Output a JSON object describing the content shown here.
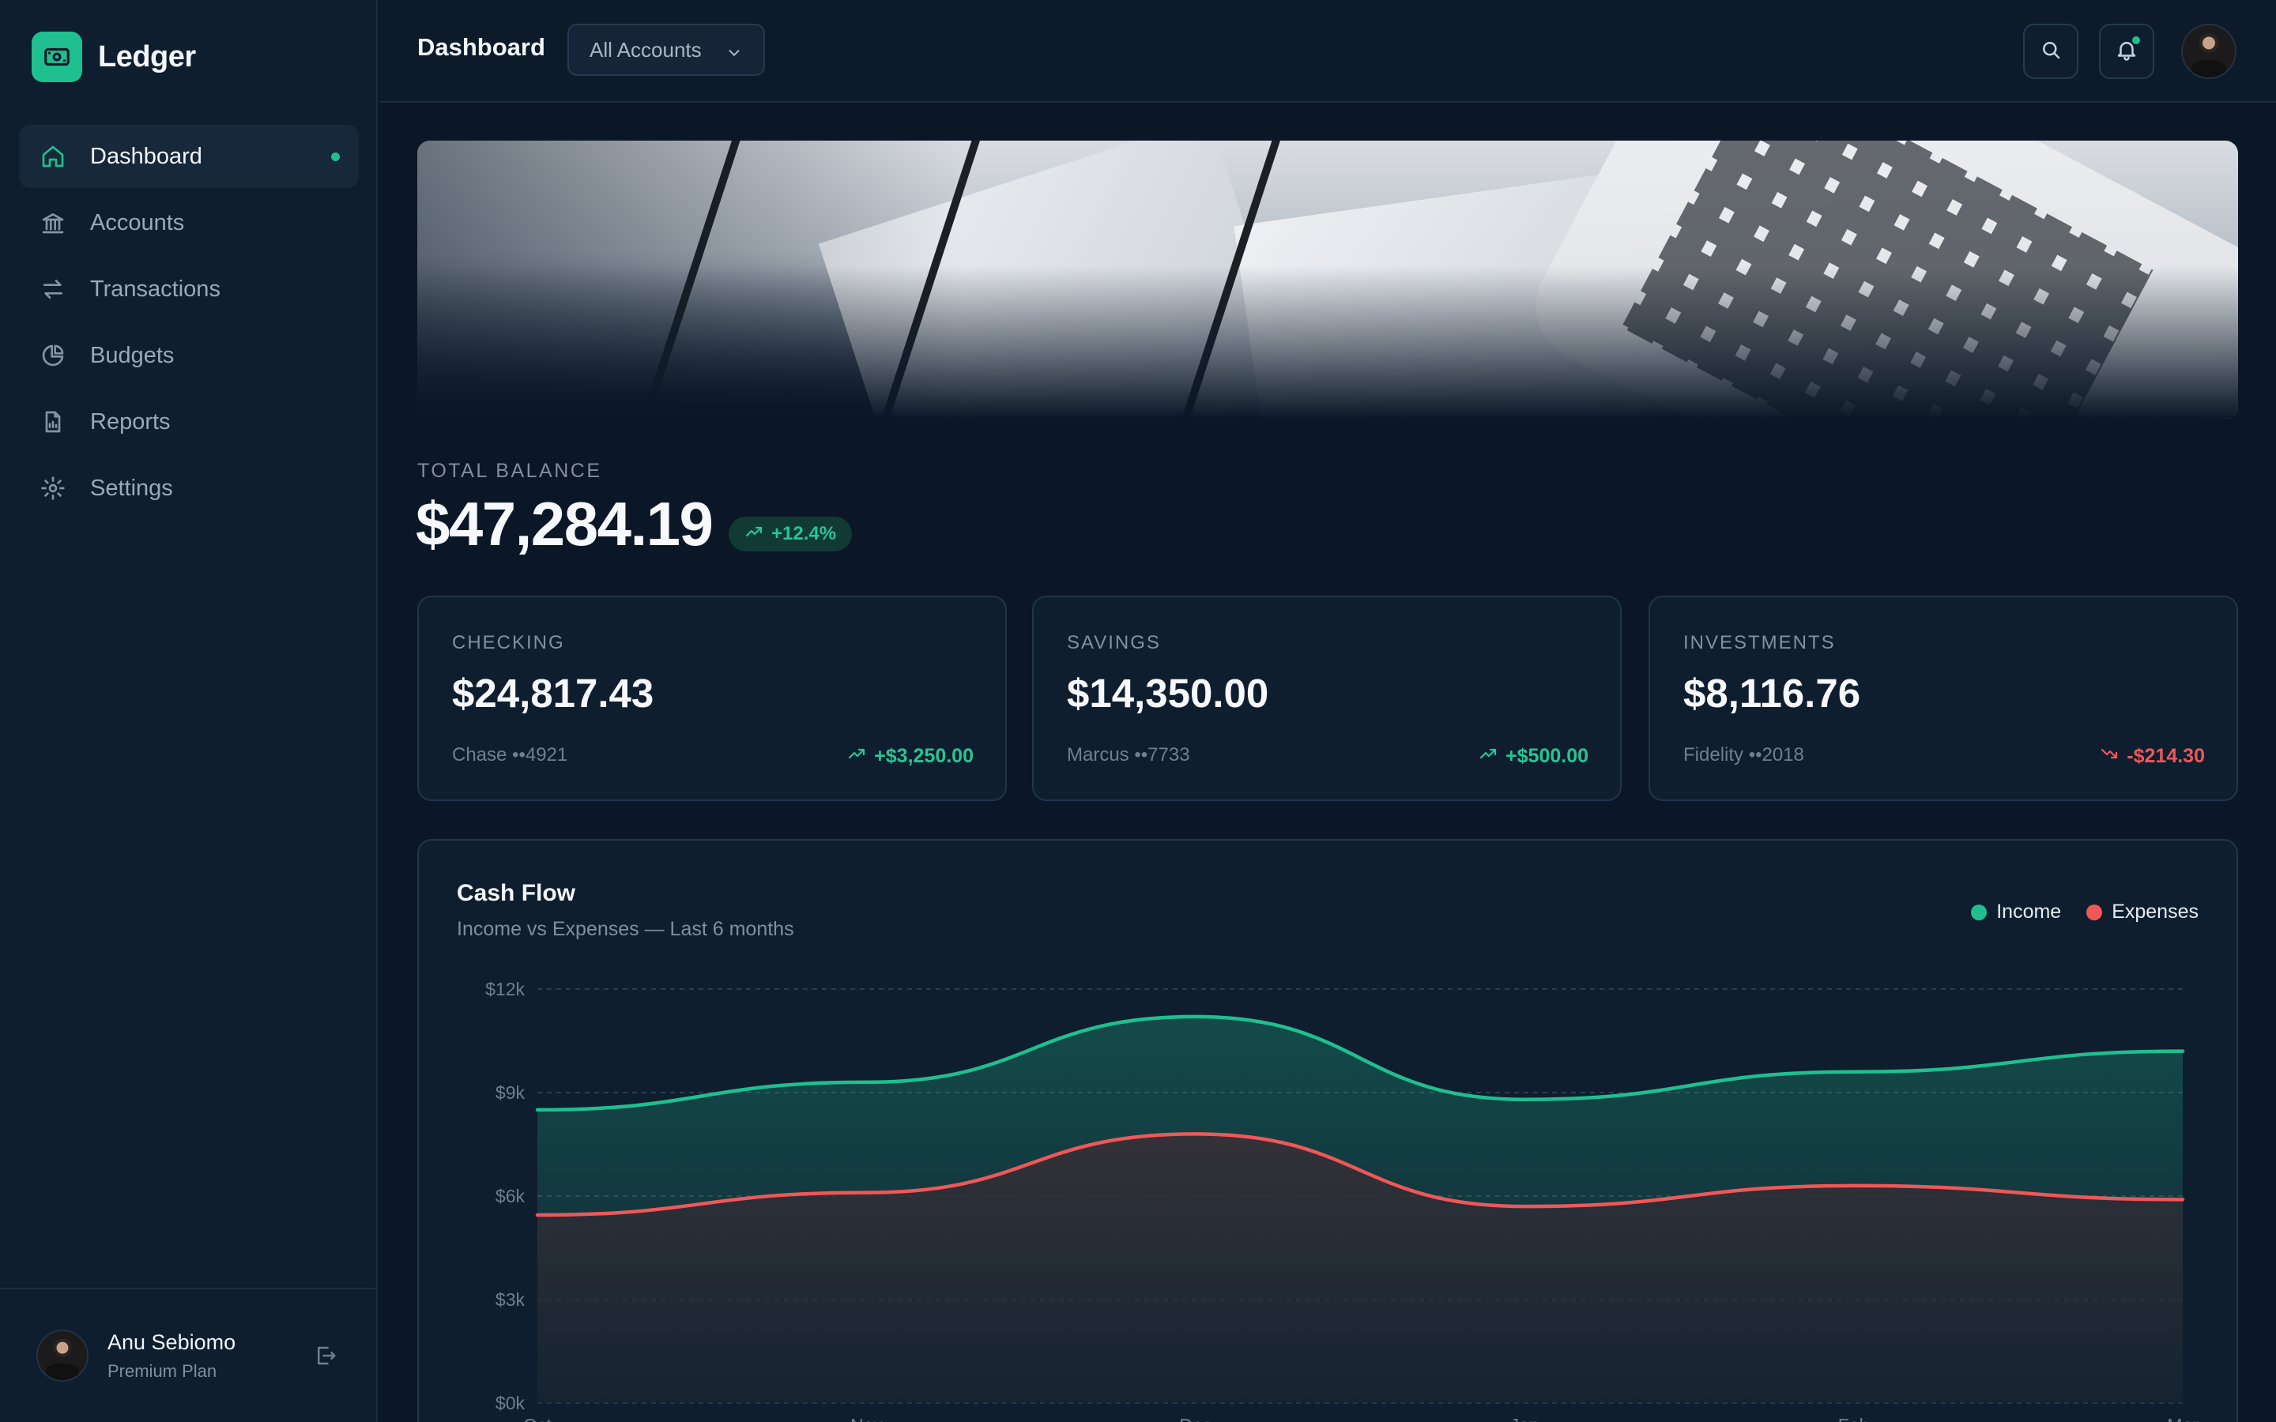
{
  "brand": {
    "name": "Ledger",
    "icon": "banknote-icon",
    "accent": "#1fbf8f"
  },
  "sidebar": {
    "items": [
      {
        "label": "Dashboard",
        "icon": "home-icon",
        "active": true
      },
      {
        "label": "Accounts",
        "icon": "bank-icon"
      },
      {
        "label": "Transactions",
        "icon": "arrows-swap-icon"
      },
      {
        "label": "Budgets",
        "icon": "pie-chart-icon"
      },
      {
        "label": "Reports",
        "icon": "report-file-icon"
      },
      {
        "label": "Settings",
        "icon": "gear-icon"
      }
    ],
    "user": {
      "name": "Anu Sebiomo",
      "plan": "Premium Plan"
    }
  },
  "header": {
    "title": "Dashboard",
    "account_filter": "All Accounts"
  },
  "balance": {
    "label": "TOTAL BALANCE",
    "amount": "$47,284.19",
    "change": "+12.4%"
  },
  "accounts": [
    {
      "label": "CHECKING",
      "amount": "$24,817.43",
      "institution": "Chase ••4921",
      "change": "+$3,250.00",
      "direction": "up"
    },
    {
      "label": "SAVINGS",
      "amount": "$14,350.00",
      "institution": "Marcus ••7733",
      "change": "+$500.00",
      "direction": "up"
    },
    {
      "label": "INVESTMENTS",
      "amount": "$8,116.76",
      "institution": "Fidelity ••2018",
      "change": "-$214.30",
      "direction": "down"
    }
  ],
  "colors": {
    "positive": "#27c595",
    "negative": "#f05757"
  },
  "chart_data": {
    "type": "area",
    "title": "Cash Flow",
    "subtitle": "Income vs Expenses — Last 6 months",
    "categories": [
      "Oct",
      "Nov",
      "Dec",
      "Jan",
      "Feb",
      "Mar"
    ],
    "ylim": [
      0,
      12000
    ],
    "yticks": [
      "$0k",
      "$3k",
      "$6k",
      "$9k",
      "$12k"
    ],
    "grid": true,
    "legend_position": "top-right",
    "series": [
      {
        "name": "Income",
        "color": "#1fbf8f",
        "values": [
          8500,
          9300,
          11200,
          8800,
          9600,
          10200
        ]
      },
      {
        "name": "Expenses",
        "color": "#f05757",
        "values": [
          5450,
          6100,
          7800,
          5700,
          6300,
          5900
        ]
      }
    ]
  }
}
